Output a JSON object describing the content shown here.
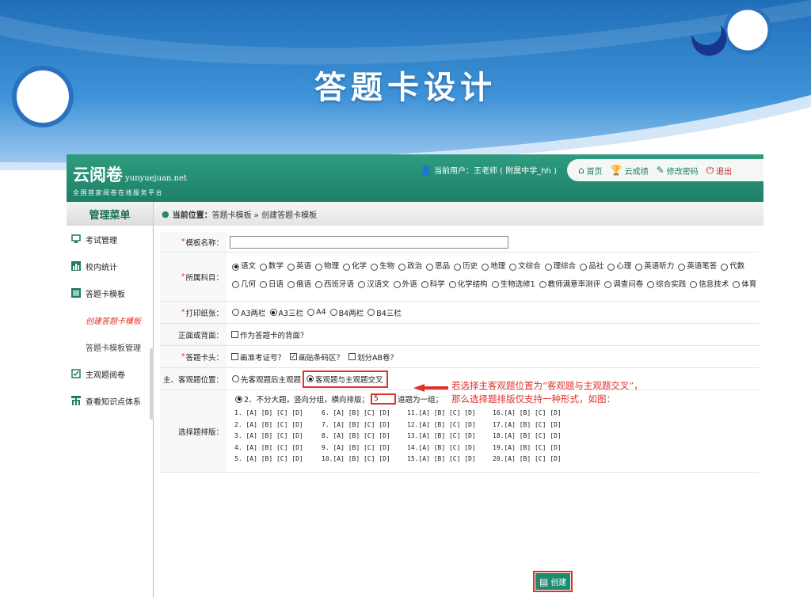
{
  "slide": {
    "title": "答题卡设计"
  },
  "app": {
    "logo_name": "云阅卷",
    "logo_domain": "yunyuejuan.net",
    "logo_tagline": "全国首家阅卷在线服务平台",
    "current_user": "当前用户：王老师 ( 附属中学_hh )",
    "nav": [
      {
        "label": "首页",
        "icon": "home-icon"
      },
      {
        "label": "云成绩",
        "icon": "trophy-icon"
      },
      {
        "label": "修改密码",
        "icon": "pen-icon"
      },
      {
        "label": "退出",
        "icon": "power-icon"
      }
    ],
    "accent": "#1c8068",
    "highlight": "#e0302a"
  },
  "sidebar": {
    "heading": "管理菜单",
    "items": [
      {
        "label": "考试管理",
        "icon": "monitor-icon"
      },
      {
        "label": "校内统计",
        "icon": "bar-chart-icon"
      },
      {
        "label": "答题卡模板",
        "icon": "list-icon"
      },
      {
        "label": "主观题阅卷",
        "icon": "check-doc-icon"
      },
      {
        "label": "查看知识点体系",
        "icon": "hierarchy-icon"
      }
    ],
    "subitems": [
      {
        "label": "创建答题卡模板",
        "active": true
      },
      {
        "label": "答题卡模板管理",
        "active": false
      }
    ]
  },
  "breadcrumb": {
    "label": "当前位置：",
    "path": "答题卡模板 » 创建答题卡模板"
  },
  "form": {
    "template_name": {
      "label": "模板名称：",
      "value": ""
    },
    "subject": {
      "label": "所属科目：",
      "options": [
        "语文",
        "数学",
        "英语",
        "物理",
        "化学",
        "生物",
        "政治",
        "思品",
        "历史",
        "地理",
        "文综合",
        "理综合",
        "品社",
        "心理",
        "英语听力",
        "英语笔答",
        "代数",
        "几何",
        "日语",
        "俄语",
        "西班牙语",
        "汉语文",
        "外语",
        "科学",
        "化学结构",
        "生物选修1",
        "教师满意率测评",
        "调查问卷",
        "综合实践",
        "信息技术",
        "体育"
      ],
      "selected": "语文"
    },
    "paper": {
      "label": "打印纸张：",
      "options": [
        "A3两栏",
        "A3三栏",
        "A4",
        "B4两栏",
        "B4三栏"
      ],
      "selected": "A3三栏"
    },
    "side": {
      "label": "正面或背面：",
      "option": "作为答题卡的背面？",
      "checked": false
    },
    "header": {
      "label": "答题卡头：",
      "options": [
        {
          "label": "画准考证号？",
          "checked": false
        },
        {
          "label": "画贴条码区？",
          "checked": true
        },
        {
          "label": "划分AB卷？",
          "checked": false
        }
      ]
    },
    "position": {
      "label": "主、客观题位置：",
      "options": [
        "先客观题后主观题",
        "客观题与主观题交叉"
      ],
      "selected": "客观题与主观题交叉"
    },
    "choice_layout": {
      "label": "选择题排版：",
      "mode_text_before": "2、不分大题，竖向分组，横向排版；",
      "group_size": "5",
      "mode_text_after": "道题为一组；",
      "rows": [
        [
          "1. [A] [B] [C] [D]",
          "6. [A] [B] [C] [D]",
          "11.[A] [B] [C] [D]",
          "16.[A] [B] [C] [D]"
        ],
        [
          "2. [A] [B] [C] [D]",
          "7. [A] [B] [C] [D]",
          "12.[A] [B] [C] [D]",
          "17.[A] [B] [C] [D]"
        ],
        [
          "3. [A] [B] [C] [D]",
          "8. [A] [B] [C] [D]",
          "13.[A] [B] [C] [D]",
          "18.[A] [B] [C] [D]"
        ],
        [
          "4. [A] [B] [C] [D]",
          "9. [A] [B] [C] [D]",
          "14.[A] [B] [C] [D]",
          "19.[A] [B] [C] [D]"
        ],
        [
          "5. [A] [B] [C] [D]",
          "10.[A] [B] [C] [D]",
          "15.[A] [B] [C] [D]",
          "20.[A] [B] [C] [D]"
        ]
      ]
    },
    "create_button": "创建"
  },
  "annotation": {
    "line1": "若选择主客观题位置为“客观题与主观题交叉”，",
    "line2": "那么选择题排版仅支持一种形式，如图："
  }
}
